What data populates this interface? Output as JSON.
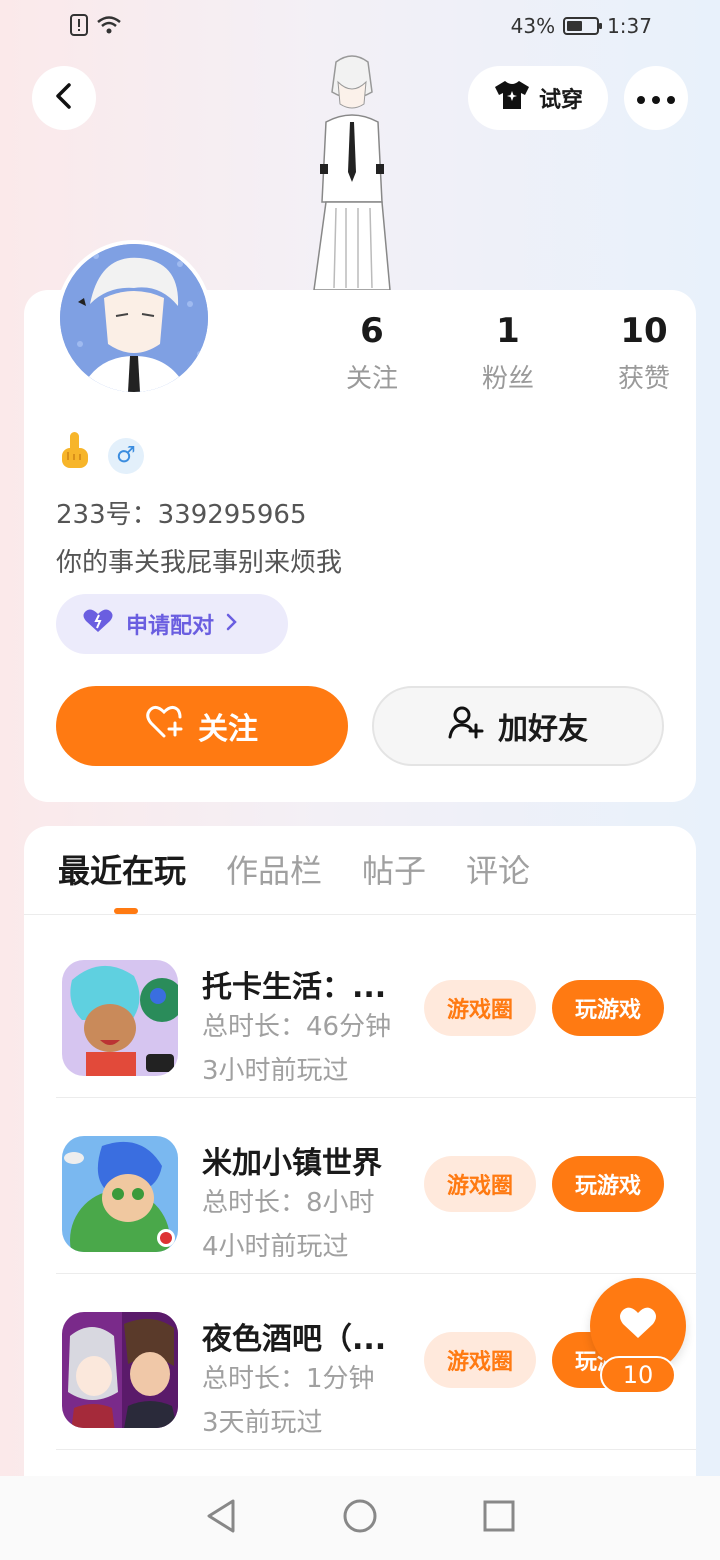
{
  "status_bar": {
    "battery": "43%",
    "time": "1:37"
  },
  "header": {
    "try_on_label": "试穿"
  },
  "profile": {
    "stats": [
      {
        "num": "6",
        "label": "关注"
      },
      {
        "num": "1",
        "label": "粉丝"
      },
      {
        "num": "10",
        "label": "获赞"
      }
    ],
    "user_id": "233号：339295965",
    "bio": "你的事关我屁事别来烦我",
    "pair_label": "申请配对",
    "follow_label": "关注",
    "add_friend_label": "加好友"
  },
  "tabs": [
    "最近在玩",
    "作品栏",
    "帖子",
    "评论"
  ],
  "games": [
    {
      "title": "托卡生活：...",
      "duration": "总时长：46分钟",
      "last_played": "3小时前玩过",
      "circle_label": "游戏圈",
      "play_label": "玩游戏"
    },
    {
      "title": "米加小镇世界",
      "duration": "总时长：8小时",
      "last_played": "4小时前玩过",
      "circle_label": "游戏圈",
      "play_label": "玩游戏"
    },
    {
      "title": "夜色酒吧（...",
      "duration": "总时长：1分钟",
      "last_played": "3天前玩过",
      "circle_label": "游戏圈",
      "play_label": "玩游戏"
    }
  ],
  "like_fab": {
    "count": "10"
  },
  "colors": {
    "accent": "#ff7a12",
    "pair_purple": "#6a5ee0"
  }
}
